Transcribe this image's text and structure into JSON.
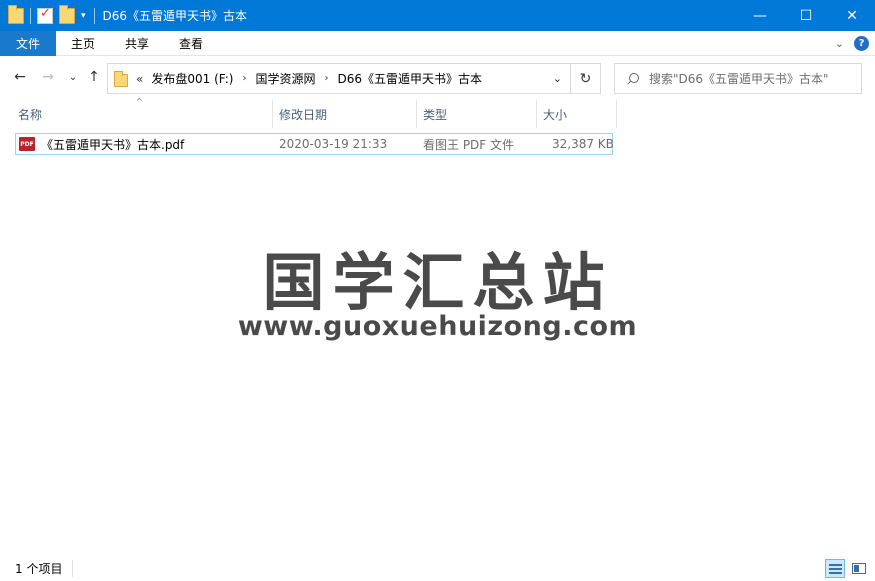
{
  "window": {
    "title": "D66《五雷遁甲天书》古本",
    "minimize_glyph": "—",
    "maximize_glyph": "☐",
    "close_glyph": "✕"
  },
  "ribbon": {
    "tabs": [
      {
        "label": "文件",
        "active": true
      },
      {
        "label": "主页",
        "active": false
      },
      {
        "label": "共享",
        "active": false
      },
      {
        "label": "查看",
        "active": false
      }
    ],
    "help_glyph": "?",
    "expand_glyph": "⌄"
  },
  "nav": {
    "back_glyph": "←",
    "forward_glyph": "→",
    "recent_glyph": "⌄",
    "up_glyph": "↑",
    "lead_glyph": "«",
    "crumb_sep": "›",
    "breadcrumbs": [
      "发布盘001 (F:)",
      "国学资源网",
      "D66《五雷遁甲天书》古本"
    ],
    "dropdown_glyph": "⌄",
    "refresh_glyph": "↻",
    "search_placeholder": "搜索\"D66《五雷遁甲天书》古本\""
  },
  "columns": {
    "name": "名称",
    "modified": "修改日期",
    "type": "类型",
    "size": "大小",
    "sort_glyph": "^"
  },
  "files": [
    {
      "icon": "pdf-file-icon",
      "icon_text": "PDF",
      "name": "《五雷遁甲天书》古本.pdf",
      "modified": "2020-03-19 21:33",
      "type": "看图王 PDF 文件",
      "size": "32,387 KB"
    }
  ],
  "watermark": {
    "chinese": "国学汇总站",
    "url": "www.guoxuehuizong.com"
  },
  "status": {
    "item_count": "1 个项目"
  },
  "colors": {
    "titlebar": "#0078d7",
    "active_tab": "#1979ca",
    "selection_border": "#99d1ff"
  }
}
